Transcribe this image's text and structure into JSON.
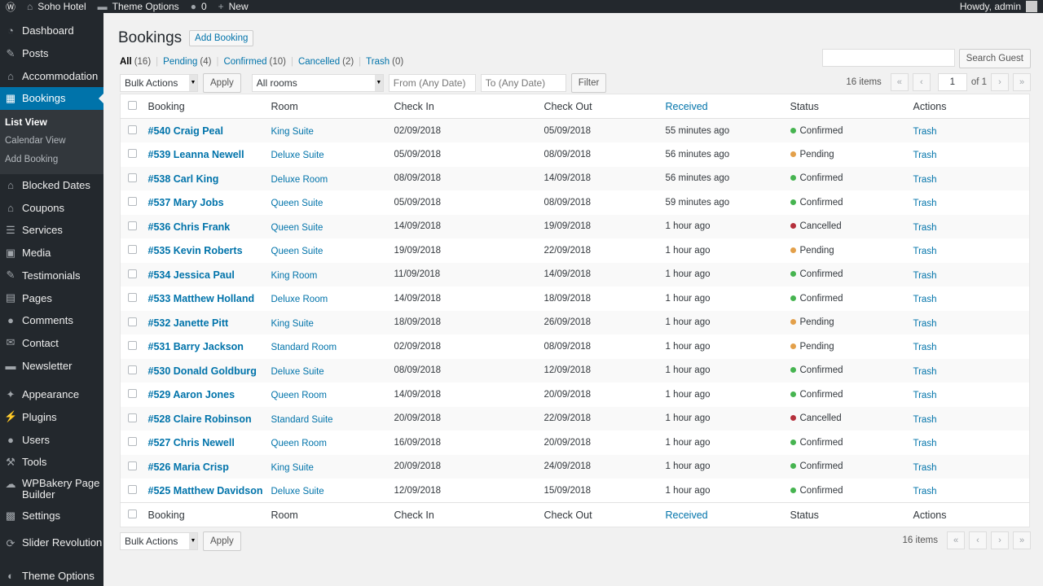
{
  "adminbar": {
    "site_name": "Soho Hotel",
    "theme_options": "Theme Options",
    "comments_count": "0",
    "new_label": "New",
    "howdy": "Howdy, admin"
  },
  "sidebar": {
    "items_top": [
      {
        "label": "Dashboard",
        "icon": "dashboard-icon",
        "glyph": "◔"
      },
      {
        "label": "Posts",
        "icon": "pin-icon",
        "glyph": "✎"
      },
      {
        "label": "Accommodation",
        "icon": "home-icon",
        "glyph": "⌂"
      },
      {
        "label": "Bookings",
        "icon": "calendar-icon",
        "glyph": "▦"
      }
    ],
    "submenu": [
      {
        "label": "List View"
      },
      {
        "label": "Calendar View"
      },
      {
        "label": "Add Booking"
      }
    ],
    "items_mid": [
      {
        "label": "Blocked Dates",
        "icon": "home-icon",
        "glyph": "⌂"
      },
      {
        "label": "Coupons",
        "icon": "home-icon",
        "glyph": "⌂"
      },
      {
        "label": "Services",
        "icon": "list-icon",
        "glyph": "☰"
      },
      {
        "label": "Media",
        "icon": "media-icon",
        "glyph": "▣"
      },
      {
        "label": "Testimonials",
        "icon": "pin-icon",
        "glyph": "✎"
      },
      {
        "label": "Pages",
        "icon": "page-icon",
        "glyph": "▤"
      },
      {
        "label": "Comments",
        "icon": "comment-icon",
        "glyph": "●"
      },
      {
        "label": "Contact",
        "icon": "mail-icon",
        "glyph": "✉"
      },
      {
        "label": "Newsletter",
        "icon": "newsletter-icon",
        "glyph": "▬"
      }
    ],
    "items_bottom": [
      {
        "label": "Appearance",
        "icon": "brush-icon",
        "glyph": "✦"
      },
      {
        "label": "Plugins",
        "icon": "plugin-icon",
        "glyph": "⚡"
      },
      {
        "label": "Users",
        "icon": "user-icon",
        "glyph": "●"
      },
      {
        "label": "Tools",
        "icon": "wrench-icon",
        "glyph": "⚒"
      },
      {
        "label": "WPBakery Page Builder",
        "icon": "builder-icon",
        "glyph": "☁"
      },
      {
        "label": "Settings",
        "icon": "settings-icon",
        "glyph": "▩"
      }
    ],
    "items_last": [
      {
        "label": "Slider Revolution",
        "icon": "slider-icon",
        "glyph": "⟳"
      },
      {
        "label": "Theme Options",
        "icon": "theme-icon",
        "glyph": "◐"
      }
    ]
  },
  "page": {
    "title": "Bookings",
    "add_button": "Add Booking"
  },
  "filters": [
    {
      "label": "All",
      "count": "(16)",
      "current": true
    },
    {
      "label": "Pending",
      "count": "(4)",
      "current": false
    },
    {
      "label": "Confirmed",
      "count": "(10)",
      "current": false
    },
    {
      "label": "Cancelled",
      "count": "(2)",
      "current": false
    },
    {
      "label": "Trash",
      "count": "(0)",
      "current": false
    }
  ],
  "search": {
    "button": "Search Guest",
    "value": ""
  },
  "tablenav": {
    "bulk_actions": "Bulk Actions",
    "apply": "Apply",
    "rooms": "All rooms",
    "from_placeholder": "From (Any Date)",
    "to_placeholder": "To (Any Date)",
    "filter": "Filter",
    "items": "16 items",
    "page": "1",
    "of": "of 1"
  },
  "columns": {
    "booking": "Booking",
    "room": "Room",
    "check_in": "Check In",
    "check_out": "Check Out",
    "received": "Received",
    "status": "Status",
    "actions": "Actions"
  },
  "status_colors": {
    "Confirmed": "#46b450",
    "Pending": "#e3a04a",
    "Cancelled": "#b5303c"
  },
  "rows": [
    {
      "booking": "#540 Craig Peal",
      "room": "King Suite",
      "check_in": "02/09/2018",
      "check_out": "05/09/2018",
      "received": "55 minutes ago",
      "status": "Confirmed",
      "action": "Trash"
    },
    {
      "booking": "#539 Leanna Newell",
      "room": "Deluxe Suite",
      "check_in": "05/09/2018",
      "check_out": "08/09/2018",
      "received": "56 minutes ago",
      "status": "Pending",
      "action": "Trash"
    },
    {
      "booking": "#538 Carl King",
      "room": "Deluxe Room",
      "check_in": "08/09/2018",
      "check_out": "14/09/2018",
      "received": "56 minutes ago",
      "status": "Confirmed",
      "action": "Trash"
    },
    {
      "booking": "#537 Mary Jobs",
      "room": "Queen Suite",
      "check_in": "05/09/2018",
      "check_out": "08/09/2018",
      "received": "59 minutes ago",
      "status": "Confirmed",
      "action": "Trash"
    },
    {
      "booking": "#536 Chris Frank",
      "room": "Queen Suite",
      "check_in": "14/09/2018",
      "check_out": "19/09/2018",
      "received": "1 hour ago",
      "status": "Cancelled",
      "action": "Trash"
    },
    {
      "booking": "#535 Kevin Roberts",
      "room": "Queen Suite",
      "check_in": "19/09/2018",
      "check_out": "22/09/2018",
      "received": "1 hour ago",
      "status": "Pending",
      "action": "Trash"
    },
    {
      "booking": "#534 Jessica Paul",
      "room": "King Room",
      "check_in": "11/09/2018",
      "check_out": "14/09/2018",
      "received": "1 hour ago",
      "status": "Confirmed",
      "action": "Trash"
    },
    {
      "booking": "#533 Matthew Holland",
      "room": "Deluxe Room",
      "check_in": "14/09/2018",
      "check_out": "18/09/2018",
      "received": "1 hour ago",
      "status": "Confirmed",
      "action": "Trash"
    },
    {
      "booking": "#532 Janette Pitt",
      "room": "King Suite",
      "check_in": "18/09/2018",
      "check_out": "26/09/2018",
      "received": "1 hour ago",
      "status": "Pending",
      "action": "Trash"
    },
    {
      "booking": "#531 Barry Jackson",
      "room": "Standard Room",
      "check_in": "02/09/2018",
      "check_out": "08/09/2018",
      "received": "1 hour ago",
      "status": "Pending",
      "action": "Trash"
    },
    {
      "booking": "#530 Donald Goldburg",
      "room": "Deluxe Suite",
      "check_in": "08/09/2018",
      "check_out": "12/09/2018",
      "received": "1 hour ago",
      "status": "Confirmed",
      "action": "Trash"
    },
    {
      "booking": "#529 Aaron Jones",
      "room": "Queen Room",
      "check_in": "14/09/2018",
      "check_out": "20/09/2018",
      "received": "1 hour ago",
      "status": "Confirmed",
      "action": "Trash"
    },
    {
      "booking": "#528 Claire Robinson",
      "room": "Standard Suite",
      "check_in": "20/09/2018",
      "check_out": "22/09/2018",
      "received": "1 hour ago",
      "status": "Cancelled",
      "action": "Trash"
    },
    {
      "booking": "#527 Chris Newell",
      "room": "Queen Room",
      "check_in": "16/09/2018",
      "check_out": "20/09/2018",
      "received": "1 hour ago",
      "status": "Confirmed",
      "action": "Trash"
    },
    {
      "booking": "#526 Maria Crisp",
      "room": "King Suite",
      "check_in": "20/09/2018",
      "check_out": "24/09/2018",
      "received": "1 hour ago",
      "status": "Confirmed",
      "action": "Trash"
    },
    {
      "booking": "#525 Matthew Davidson",
      "room": "Deluxe Suite",
      "check_in": "12/09/2018",
      "check_out": "15/09/2018",
      "received": "1 hour ago",
      "status": "Confirmed",
      "action": "Trash"
    }
  ]
}
